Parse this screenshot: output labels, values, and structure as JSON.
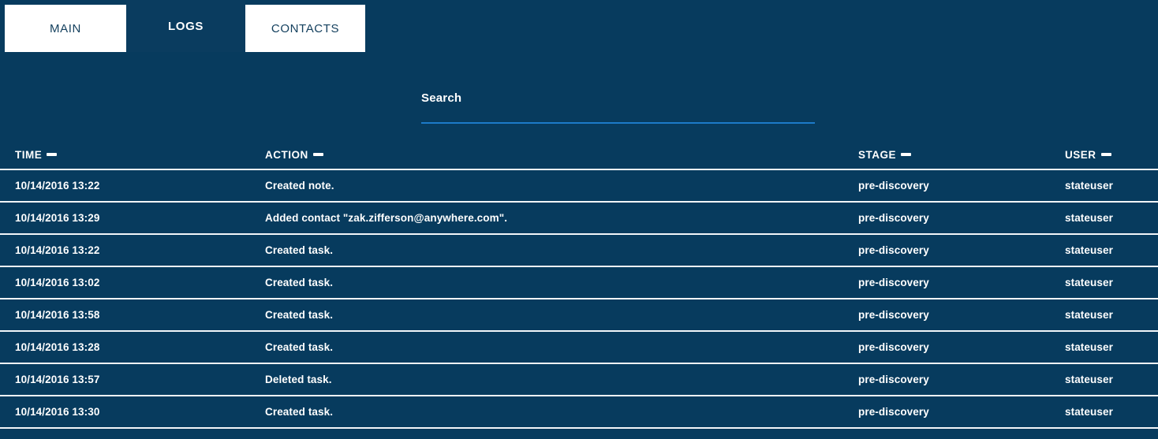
{
  "theme": {
    "background": "#073b5e",
    "tab_active_bg": "#0a3c5f",
    "tab_inactive_bg": "#ffffff",
    "tab_inactive_text": "#14405e",
    "text": "#ffffff",
    "divider": "#f2f6f9",
    "search_underline": "#1c7ac9"
  },
  "tabs": [
    {
      "label": "MAIN",
      "active": false
    },
    {
      "label": "LOGS",
      "active": true
    },
    {
      "label": "CONTACTS",
      "active": false
    }
  ],
  "search": {
    "label": "Search",
    "value": "",
    "placeholder": ""
  },
  "table": {
    "columns": [
      {
        "label": "TIME",
        "sort_icon": "dash-icon"
      },
      {
        "label": "ACTION",
        "sort_icon": "dash-icon"
      },
      {
        "label": "STAGE",
        "sort_icon": "dash-icon"
      },
      {
        "label": "USER",
        "sort_icon": "dash-icon"
      }
    ],
    "rows": [
      {
        "time": "10/14/2016 13:22",
        "action": "Created note.",
        "stage": "pre-discovery",
        "user": "stateuser"
      },
      {
        "time": "10/14/2016 13:29",
        "action": "Added contact \"zak.zifferson@anywhere.com\".",
        "stage": "pre-discovery",
        "user": "stateuser"
      },
      {
        "time": "10/14/2016 13:22",
        "action": "Created task.",
        "stage": "pre-discovery",
        "user": "stateuser"
      },
      {
        "time": "10/14/2016 13:02",
        "action": "Created task.",
        "stage": "pre-discovery",
        "user": "stateuser"
      },
      {
        "time": "10/14/2016 13:58",
        "action": "Created task.",
        "stage": "pre-discovery",
        "user": "stateuser"
      },
      {
        "time": "10/14/2016 13:28",
        "action": "Created task.",
        "stage": "pre-discovery",
        "user": "stateuser"
      },
      {
        "time": "10/14/2016 13:57",
        "action": "Deleted task.",
        "stage": "pre-discovery",
        "user": "stateuser"
      },
      {
        "time": "10/14/2016 13:30",
        "action": "Created task.",
        "stage": "pre-discovery",
        "user": "stateuser"
      }
    ]
  }
}
